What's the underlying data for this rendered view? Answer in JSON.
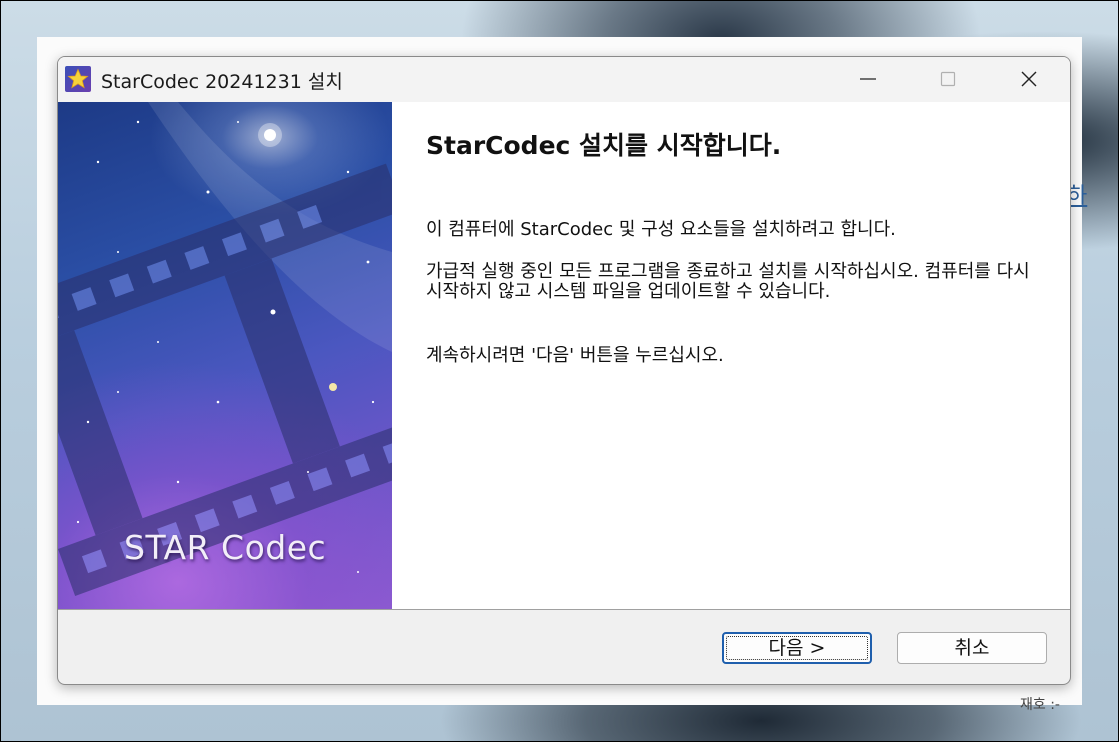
{
  "background": {
    "side_glyph": "하",
    "bottom_text": "재호 :-"
  },
  "window": {
    "title": "StarCodec 20241231 설치",
    "icon": "star-icon",
    "controls": {
      "minimize": "minimize-icon",
      "maximize": "maximize-icon",
      "close": "close-icon"
    }
  },
  "banner": {
    "logo_text": "STAR Codec"
  },
  "content": {
    "heading": "StarCodec 설치를 시작합니다.",
    "paragraph1": "이 컴퓨터에 StarCodec 및 구성 요소들을 설치하려고 합니다.",
    "paragraph2": "가급적 실행 중인 모든 프로그램을 종료하고 설치를 시작하십시오. 컴퓨터를 다시 시작하지 않고 시스템 파일을 업데이트할 수 있습니다.",
    "paragraph3": "계속하시려면 '다음' 버튼을 누르십시오."
  },
  "buttons": {
    "next": "다음 >",
    "cancel": "취소"
  },
  "colors": {
    "accent": "#1f5fad",
    "banner_top": "#1d3a86",
    "banner_bottom": "#8a5bd0"
  }
}
